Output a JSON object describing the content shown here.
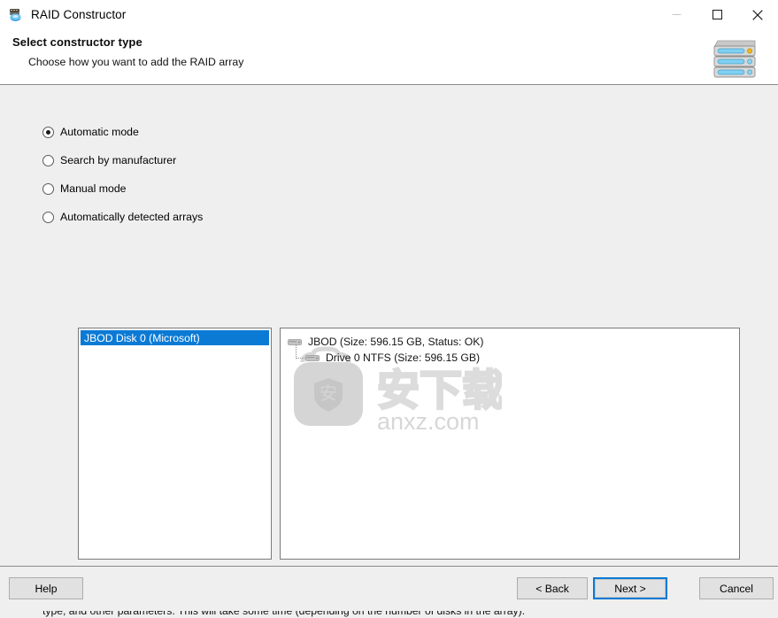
{
  "window": {
    "title": "RAID Constructor",
    "icon": "raid-constructor-icon",
    "controls": {
      "minimize": "minimize-icon",
      "maximize": "maximize-icon",
      "close": "close-icon"
    }
  },
  "header": {
    "title": "Select constructor type",
    "subtitle": "Choose how you want to add the RAID array",
    "icon": "disk-array-stack-icon"
  },
  "options": {
    "items": [
      {
        "label": "Automatic mode",
        "checked": true
      },
      {
        "label": "Search by manufacturer",
        "checked": false
      },
      {
        "label": "Manual mode",
        "checked": false
      },
      {
        "label": "Automatically detected arrays",
        "checked": false
      }
    ]
  },
  "disk_list": {
    "items": [
      {
        "label": "JBOD Disk 0 (Microsoft)",
        "selected": true
      }
    ]
  },
  "array_tree": {
    "nodes": [
      {
        "label": "JBOD (Size: 596.15 GB, Status: OK)",
        "icon": "drive-icon",
        "level": 0
      },
      {
        "label": "Drive 0 NTFS (Size: 596.15 GB)",
        "icon": "drive-icon",
        "level": 1
      }
    ]
  },
  "watermark": {
    "cn_text": "安下载",
    "domain": "anxz.com",
    "shield_char": "安"
  },
  "description": {
    "text": "This mode is fully automatic. Just specify the hard disks that made up the array, and the program will automatically determine their order, array type, and other parameters. This will take some time (depending on the number of disks in the array)."
  },
  "footer": {
    "help": "Help",
    "back": "< Back",
    "next": "Next >",
    "cancel": "Cancel"
  },
  "colors": {
    "accent": "#0b7ad5",
    "window_bg": "#efefef",
    "panel_bg": "#ffffff",
    "border": "#7a7a7a"
  }
}
